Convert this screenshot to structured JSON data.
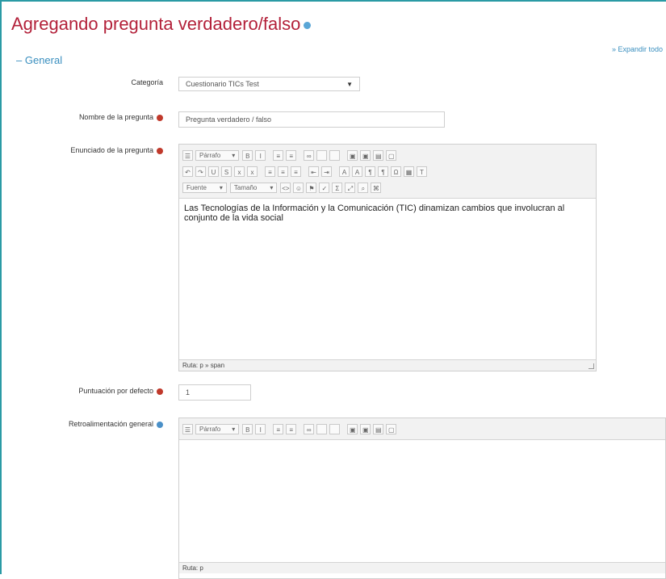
{
  "header": {
    "title": "Agregando pregunta verdadero/falso",
    "expand_all": "» Expandir todo"
  },
  "section": {
    "label": "General",
    "toggle": "–"
  },
  "fields": {
    "category": {
      "label": "Categoría",
      "value": "Cuestionario TICs Test"
    },
    "question_name": {
      "label": "Nombre de la pregunta",
      "value": "Pregunta verdadero / falso"
    },
    "question_text": {
      "label": "Enunciado de la pregunta",
      "content": "Las Tecnologías de la Información y la Comunicación (TIC) dinamizan cambios que involucran al conjunto de la vida social",
      "path": "Ruta: p » span"
    },
    "default_mark": {
      "label": "Puntuación por defecto",
      "value": "1"
    },
    "general_feedback": {
      "label": "Retroalimentación general",
      "path": "Ruta: p"
    }
  },
  "toolbar": {
    "paragraph_select": "Párrafo",
    "font_select": "Fuente",
    "size_select": "Tamaño",
    "row1_icons": [
      "toggle-icon",
      "bold-icon",
      "italic-icon",
      "bullet-list-icon",
      "numbered-list-icon",
      "link-icon",
      "unlink-icon",
      "anchor-icon",
      "image-icon",
      "media-icon",
      "file-icon",
      "paste-icon"
    ],
    "row2_icons": [
      "undo-icon",
      "redo-icon",
      "underline-icon",
      "strikethrough-icon",
      "subscript-icon",
      "superscript-icon",
      "align-left-icon",
      "align-center-icon",
      "align-right-icon",
      "outdent-icon",
      "indent-icon",
      "text-color-icon",
      "background-color-icon",
      "ltr-icon",
      "rtl-icon",
      "special-char-icon",
      "table-icon",
      "clear-format-icon"
    ],
    "row3_icons": [
      "code-icon",
      "emoticon-icon",
      "bookmark-icon",
      "spell-icon",
      "equation-icon",
      "fullscreen-icon",
      "search-replace-icon",
      "html-icon"
    ]
  },
  "colors": {
    "title": "#b3213a",
    "link": "#3a8fbf",
    "required": "#c0392b",
    "frame": "#2a9aa5"
  }
}
